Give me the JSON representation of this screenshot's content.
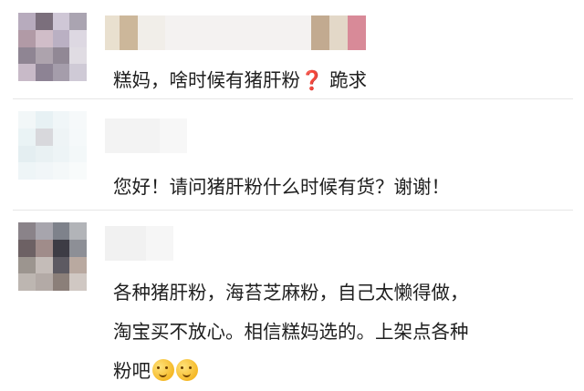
{
  "comments": [
    {
      "text": "糕妈，啥时候有猪肝粉",
      "mark": "❓",
      "text_after": "跪求"
    },
    {
      "text": "您好！请问猪肝粉什么时候有货？谢谢！"
    },
    {
      "lines": [
        "各种猪肝粉，海苔芝麻粉，自己太懒得做，",
        "淘宝买不放心。相信糕妈选的。上架点各种",
        "粉吧"
      ],
      "emojis": [
        "thinking-face-icon",
        "thinking-face-icon"
      ]
    }
  ]
}
